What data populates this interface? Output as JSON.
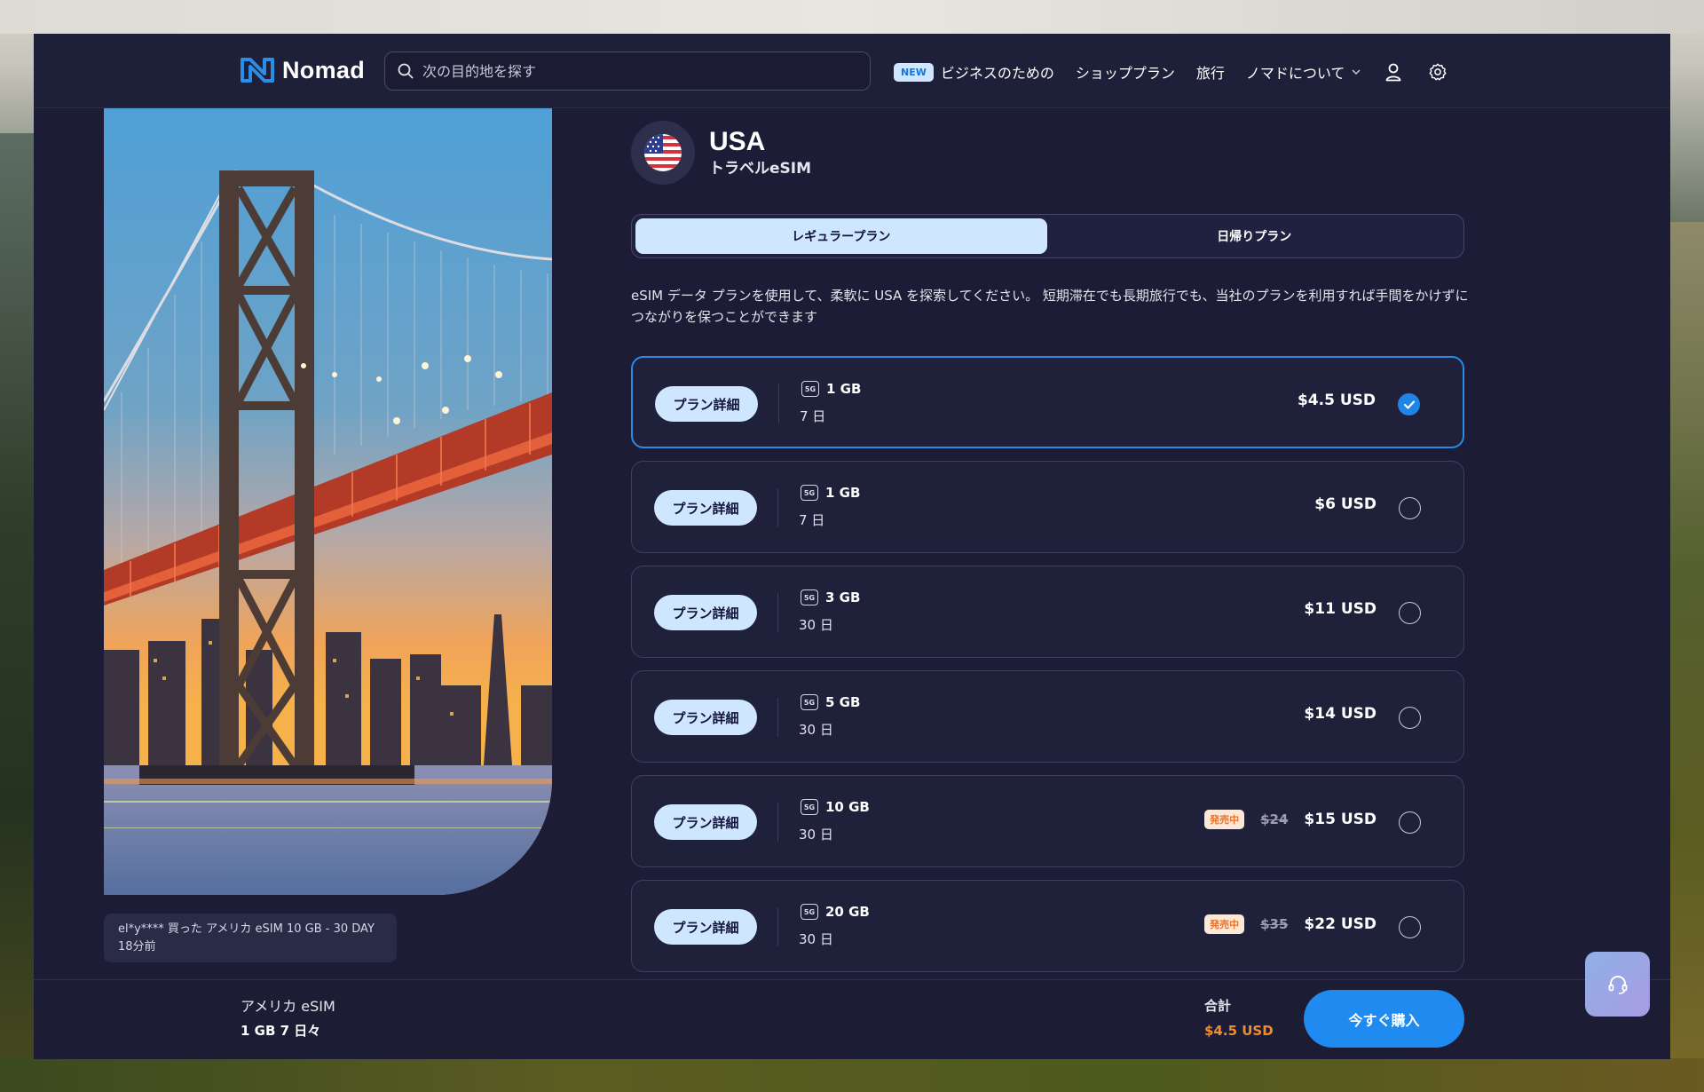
{
  "brand": {
    "name": "Nomad",
    "accent": "#1f8af0"
  },
  "search": {
    "placeholder": "次の目的地を探す"
  },
  "nav": {
    "new_badge": "NEW",
    "business": "ビジネスのための",
    "shop_plans": "ショッププラン",
    "travel": "旅行",
    "about": "ノマドについて",
    "icons": [
      "user-icon",
      "gear-icon"
    ]
  },
  "toast": {
    "line1": "el*y**** 買った アメリカ eSIM 10 GB - 30 DAY",
    "line2": "18分前"
  },
  "country": {
    "name": "USA",
    "subtitle": "トラベルeSIM",
    "flag": "us-flag"
  },
  "tabs": [
    {
      "label": "レギュラープラン",
      "active": true
    },
    {
      "label": "日帰りプラン",
      "active": false
    }
  ],
  "description": "eSIM データ プランを使用して、柔軟に USA を探索してください。 短期滞在でも長期旅行でも、当社のプランを利用すれば手間をかけずにつながりを保つことができます",
  "plan_detail_label": "プラン詳細",
  "plan_5g_label": "5G",
  "plans": [
    {
      "data": "1 GB",
      "days": "7 日",
      "price": "$4.5 USD",
      "selected": true
    },
    {
      "data": "1 GB",
      "days": "7 日",
      "price": "$6 USD",
      "selected": false
    },
    {
      "data": "3 GB",
      "days": "30 日",
      "price": "$11 USD",
      "selected": false
    },
    {
      "data": "5 GB",
      "days": "30 日",
      "price": "$14 USD",
      "selected": false
    },
    {
      "data": "10 GB",
      "days": "30 日",
      "price": "$15 USD",
      "old_price": "$24",
      "sale": "発売中",
      "selected": false
    },
    {
      "data": "20 GB",
      "days": "30 日",
      "price": "$22 USD",
      "old_price": "$35",
      "sale": "発売中",
      "selected": false
    }
  ],
  "footer": {
    "title": "アメリカ eSIM",
    "subtitle": "1 GB 7 日々",
    "total_label": "合計",
    "total_price": "$4.5 USD",
    "buy_label": "今すぐ購入"
  },
  "colors": {
    "background": "#1c1c36",
    "sale": "#e7742c",
    "selected_border": "#2a8ae6"
  }
}
